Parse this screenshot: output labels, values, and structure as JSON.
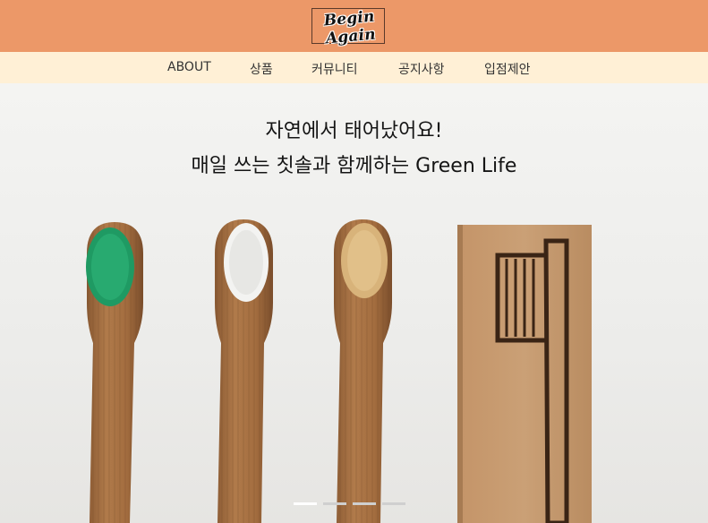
{
  "header": {
    "logo_text": "Begin Again",
    "brand_color": "#ec9868"
  },
  "nav": {
    "background": "#fff0d6",
    "items": [
      {
        "label": "ABOUT"
      },
      {
        "label": "상품"
      },
      {
        "label": "커뮤니티"
      },
      {
        "label": "공지사항"
      },
      {
        "label": "입점제안"
      }
    ]
  },
  "hero": {
    "line1": "자연에서 태어났어요!",
    "line2": "매일 쓰는 칫솔과 함께하는 Green Life",
    "image_subject": "bamboo-toothbrushes-photo",
    "bristle_colors": [
      "#1f9a63",
      "#f2f2f2",
      "#d8b37a"
    ],
    "slides": {
      "count": 4,
      "active_index": 0
    }
  }
}
